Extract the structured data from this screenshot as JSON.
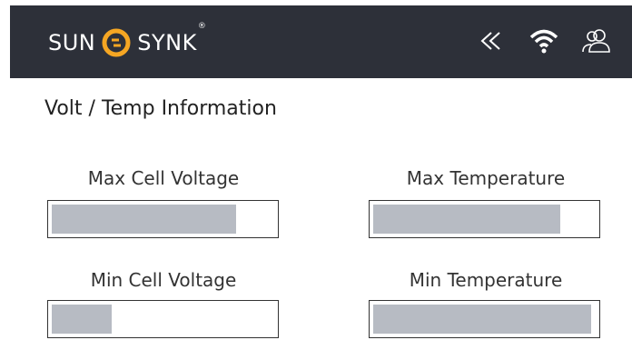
{
  "header": {
    "brand_left": "SUN",
    "brand_right": "SYNK",
    "brand_reg": "®",
    "icons": [
      "double-chevron-left-icon",
      "wifi-icon",
      "users-icon"
    ]
  },
  "page": {
    "title": "Volt / Temp Information"
  },
  "fields": {
    "max_cell_voltage": {
      "label": "Max Cell Voltage",
      "fill_fraction": 0.83
    },
    "max_temperature": {
      "label": "Max Temperature",
      "fill_fraction": 0.84
    },
    "min_cell_voltage": {
      "label": "Min Cell Voltage",
      "fill_fraction": 0.27
    },
    "min_temperature": {
      "label": "Min Temperature",
      "fill_fraction": 0.98
    }
  },
  "colors": {
    "header_bg": "#2d3039",
    "accent": "#f5a623",
    "fill": "#b7bbc3"
  }
}
